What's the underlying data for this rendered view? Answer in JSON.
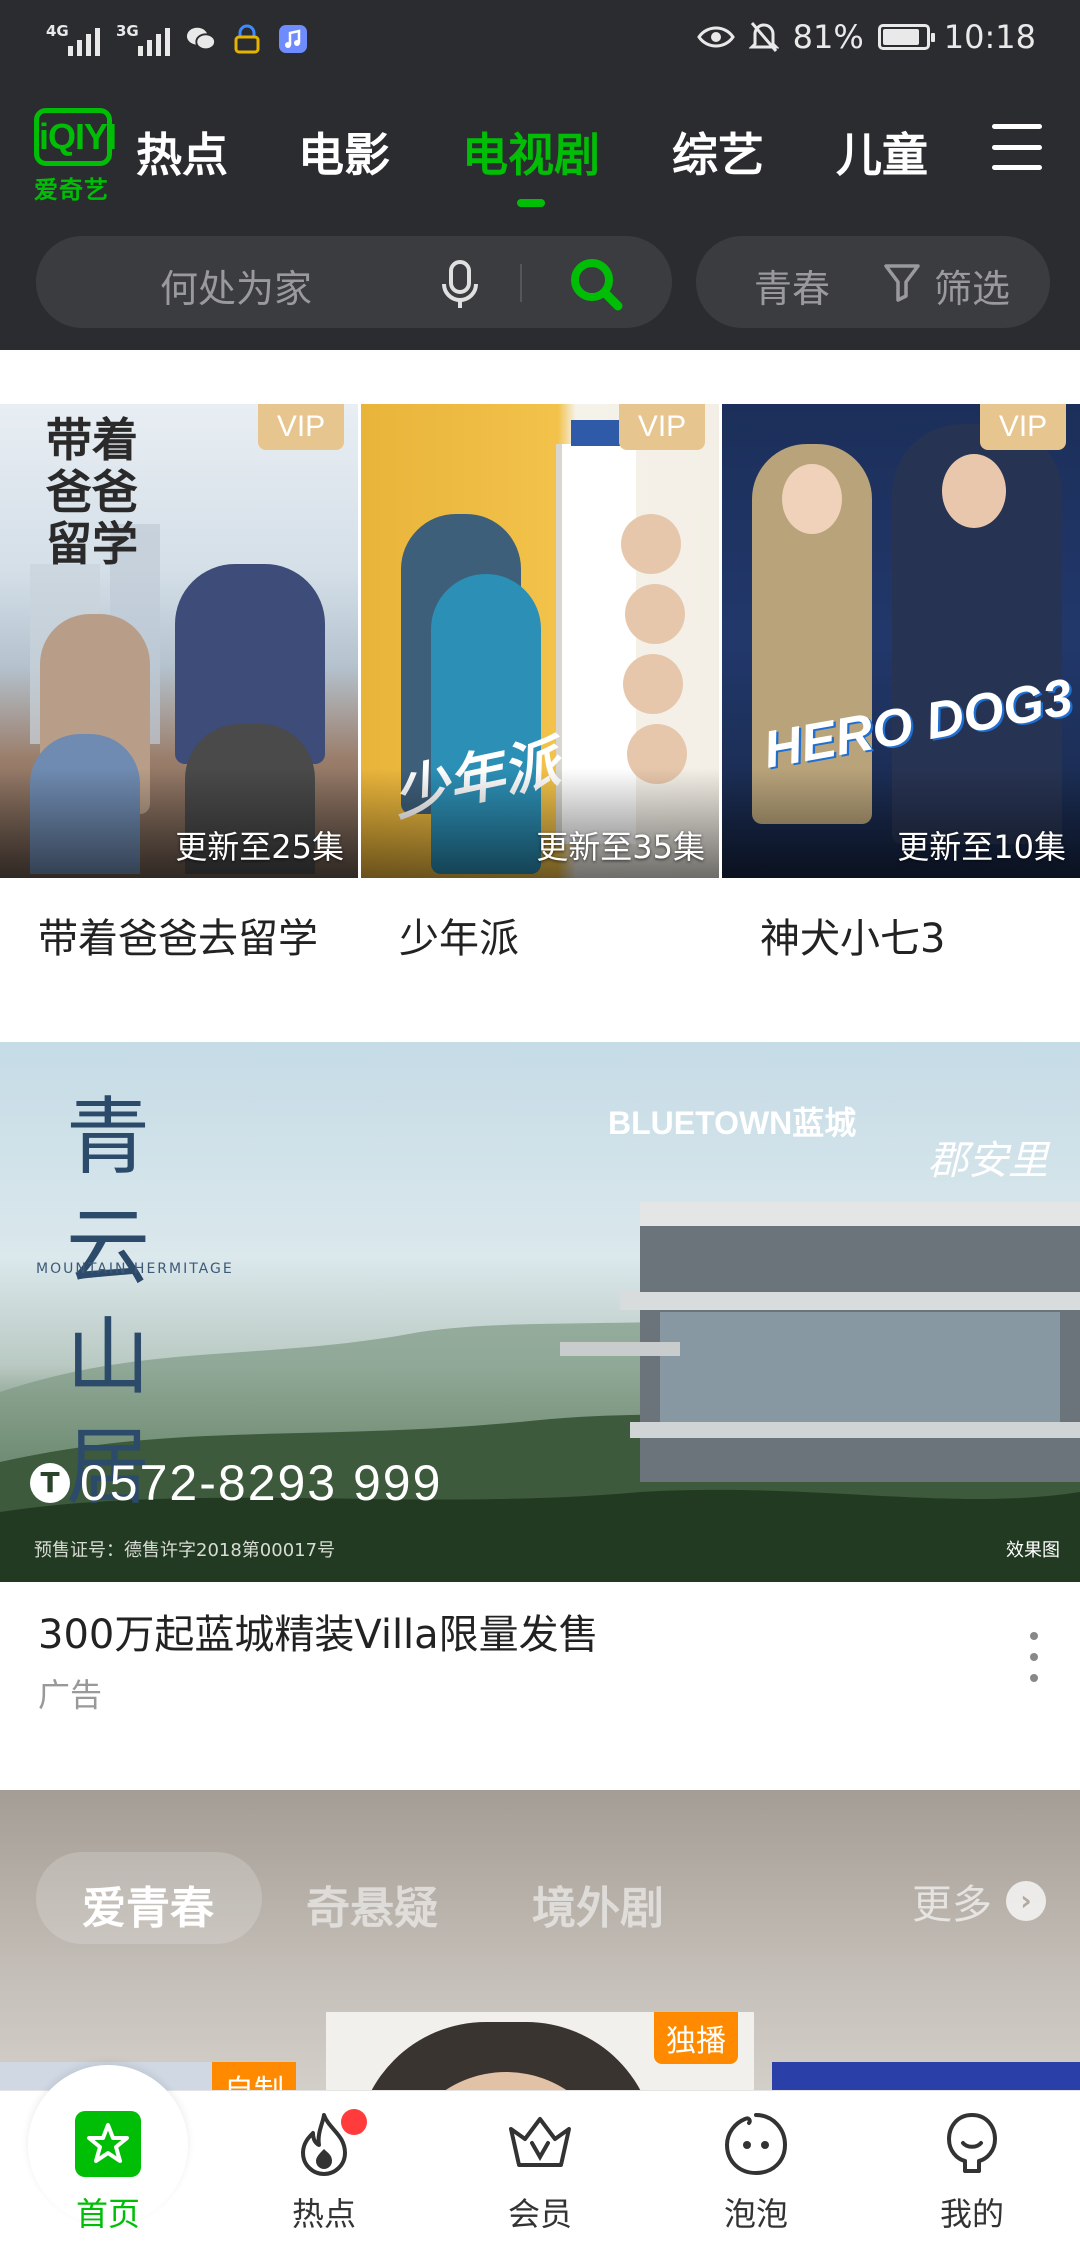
{
  "status_bar": {
    "network_1": "4G",
    "network_2": "3G",
    "battery": "81%",
    "time": "10:18",
    "icons": [
      "signal-icon",
      "signal-icon",
      "wechat-icon",
      "lock-icon",
      "music-app-icon",
      "eye-icon",
      "mute-bell-icon",
      "battery-icon"
    ]
  },
  "app": {
    "logo_text": "iQIYI",
    "logo_cn": "爱奇艺",
    "brand_color": "#00be06"
  },
  "tabs": [
    {
      "label": "热点",
      "shown": "热点"
    },
    {
      "label": "电影"
    },
    {
      "label": "电视剧",
      "active": true
    },
    {
      "label": "综艺"
    },
    {
      "label": "儿童"
    }
  ],
  "search": {
    "placeholder": "何处为家"
  },
  "filter": {
    "genre": "青春",
    "label": "筛选"
  },
  "shows": [
    {
      "title": "带着爸爸去留学",
      "badge": "VIP",
      "episodes": "更新至25集",
      "poster_text": "带着爸爸留学"
    },
    {
      "title": "少年派",
      "badge": "VIP",
      "episodes": "更新至35集",
      "poster_text": "少年派"
    },
    {
      "title": "神犬小七3",
      "badge": "VIP",
      "episodes": "更新至10集",
      "poster_text": "HERO DOG3"
    }
  ],
  "ad": {
    "headline": "300万起蓝城精装Villa限量发售",
    "label": "广告",
    "image_title": "青云山居",
    "image_subtitle_en": "MOUNTAIN HERMITAGE",
    "brand": "BLUETOWN蓝城",
    "brand2": "郡安里",
    "phone": "0572-8293 999",
    "permit": "预售证号：德售许字2018第00017号",
    "effect_note": "效果图"
  },
  "category": {
    "tabs": [
      "爱青春",
      "奇悬疑",
      "境外剧"
    ],
    "active_index": 0,
    "more": "更多",
    "badges": [
      "自制",
      "独播"
    ]
  },
  "bottom_nav": [
    {
      "label": "首页",
      "icon": "home-star-icon",
      "active": true
    },
    {
      "label": "热点",
      "icon": "flame-icon",
      "has_dot": true
    },
    {
      "label": "会员",
      "icon": "crown-icon"
    },
    {
      "label": "泡泡",
      "icon": "bubble-face-icon"
    },
    {
      "label": "我的",
      "icon": "profile-icon"
    }
  ]
}
